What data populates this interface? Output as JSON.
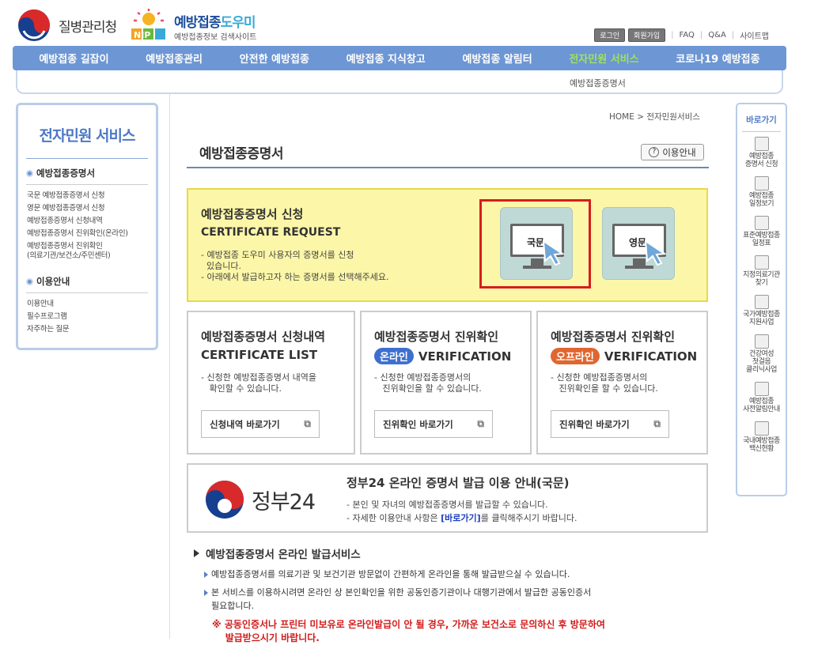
{
  "header": {
    "kdca_name": "질병관리청",
    "nip_title_a": "예방접종",
    "nip_title_b": "도우미",
    "nip_sub": "예방접종정보 검색사이트",
    "nip_letters": "NIP",
    "util": {
      "login": "로그인",
      "join": "회원가입",
      "faq": "FAQ",
      "qna": "Q&A",
      "sitemap": "사이트맵"
    }
  },
  "gnb": [
    "예방접종 길잡이",
    "예방접종관리",
    "안전한 예방접종",
    "예방접종 지식창고",
    "예방접종 알림터",
    "전자민원 서비스",
    "코로나19 예방접종"
  ],
  "gnb_active": 5,
  "subnav": "예방접종증명서",
  "sidebar": {
    "title": "전자민원 서비스",
    "sec1": "예방접종증명서",
    "sec1_items": [
      "국문 예방접종증명서 신청",
      "영문 예방접종증명서 신청",
      "예방접종증명서 신청내역",
      "예방접종증명서 진위확인(온라인)",
      "예방접종증명서 진위확인",
      "(의료기관/보건소/주민센터)"
    ],
    "sec2": "이용안내",
    "sec2_items": [
      "이용안내",
      "필수프로그램",
      "자주하는 질문"
    ]
  },
  "breadcrumb": "HOME > 전자민원서비스",
  "page_title": "예방접종증명서",
  "guide_btn": "이용안내",
  "request": {
    "title": "예방접종증명서 신청",
    "eng": "CERTIFICATE REQUEST",
    "desc1": "- 예방접종 도우미 사용자의 증명서를 신청",
    "desc1b": "있습니다.",
    "desc2": "- 아래에서 발급하고자 하는 증명서를 선택해주세요.",
    "korean": "국문",
    "english": "영문"
  },
  "cards": [
    {
      "title": "예방접종증명서 신청내역",
      "eng": "CERTIFICATE LIST",
      "pill": "",
      "d1": "- 신청한 예방접종증명서 내역을",
      "d2": "확인할 수 있습니다.",
      "btn": "신청내역 바로가기"
    },
    {
      "title": "예방접종증명서 진위확인",
      "eng": "VERIFICATION",
      "pill": "온라인",
      "d1": "- 신청한 예방접종증명서의",
      "d2": "진위확인을 할 수 있습니다.",
      "btn": "진위확인 바로가기"
    },
    {
      "title": "예방접종증명서 진위확인",
      "eng": "VERIFICATION",
      "pill": "오프라인",
      "d1": "- 신청한 예방접종증명서의",
      "d2": "진위확인을 할 수 있습니다.",
      "btn": "진위확인 바로가기"
    }
  ],
  "pill_colors": {
    "online": "#3d6fcf",
    "offline": "#e0662f"
  },
  "gov24": {
    "logo_text": "정부24",
    "title": "정부24 온라인 증명서 발급 이용 안내(국문)",
    "line1": "- 본인 및 자녀의 예방접종증명서를 발급할 수 있습니다.",
    "line2a": "- 자세한 이용안내 사항은 ",
    "line2link": "[바로가기]",
    "line2b": "를 클릭해주시기 바랍니다."
  },
  "online": {
    "heading": "예방접종증명서 온라인 발급서비스",
    "b1": "예방접종증명서를 의료기관 및 보건기관 방문없이 간편하게 온라인을 통해 발급받으실 수 있습니다.",
    "b2": "본 서비스를 이용하시려면 온라인 상 본인확인을 위한 공동인증기관이나 대행기관에서 발급한 공동인증서",
    "b2b": "필요합니다.",
    "warn1": "※ 공동인증서나 프린터 미보유로 온라인발급이 안 될 경우, 가까운 보건소로 문의하신 후 방문하여",
    "warn2": "발급받으시기 바랍니다."
  },
  "quick": {
    "title": "바로가기",
    "items": [
      "예방접종|증명서 신청",
      "예방접종|일정보기",
      "표준예방접종|일정표",
      "지정의료기관|찾기",
      "국가예방접종|지원사업",
      "건강여성|첫걸음|클리닉사업",
      "예방접종|사전알림안내",
      "국내예방접종|백신현황"
    ]
  }
}
